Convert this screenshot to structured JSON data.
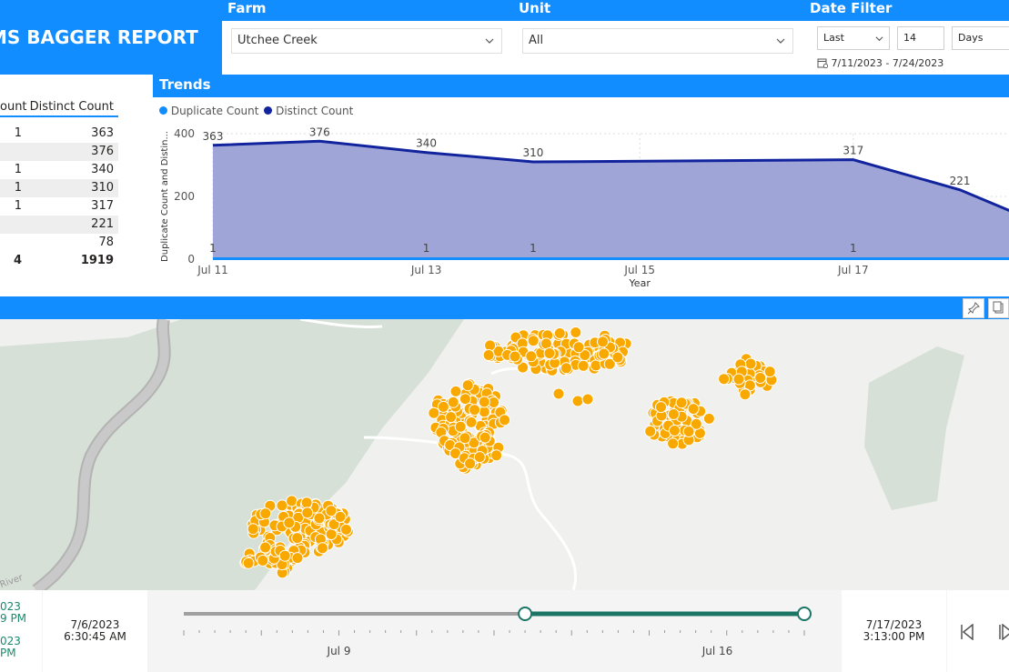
{
  "header": {
    "title": "MS BAGGER REPORT"
  },
  "farm": {
    "label": "Farm",
    "value": "Utchee Creek"
  },
  "unit": {
    "label": "Unit",
    "value": "All"
  },
  "date_filter": {
    "label": "Date Filter",
    "mode": "Last",
    "amount": "14",
    "period": "Days",
    "range": "7/11/2023 - 7/24/2023"
  },
  "table": {
    "col1_header": "ount",
    "col2_header": "Distinct Count",
    "rows": [
      {
        "c1": "1",
        "c2": "363"
      },
      {
        "c1": "",
        "c2": "376"
      },
      {
        "c1": "1",
        "c2": "340"
      },
      {
        "c1": "1",
        "c2": "310"
      },
      {
        "c1": "1",
        "c2": "317"
      },
      {
        "c1": "",
        "c2": "221"
      },
      {
        "c1": "",
        "c2": "78"
      }
    ],
    "total": {
      "c1": "4",
      "c2": "1919"
    }
  },
  "trends": {
    "title": "Trends",
    "legend": [
      "Duplicate Count",
      "Distinct Count"
    ]
  },
  "chart_data": {
    "type": "area",
    "title": "",
    "xlabel": "Year",
    "ylabel": "Duplicate Count and Distin...",
    "ylim": [
      0,
      400
    ],
    "yticks": [
      "0",
      "200",
      "400"
    ],
    "xticks": [
      "Jul 11",
      "Jul 13",
      "Jul 15",
      "Jul 17"
    ],
    "series": [
      {
        "name": "Distinct Count",
        "color": "#12239E",
        "x": [
          "Jul 11",
          "Jul 12",
          "Jul 13",
          "Jul 14",
          "Jul 17",
          "Jul 18",
          "Jul 19"
        ],
        "values": [
          363,
          376,
          340,
          310,
          317,
          221,
          78
        ]
      },
      {
        "name": "Duplicate Count",
        "color": "#118DFF",
        "x": [
          "Jul 11",
          "Jul 13",
          "Jul 14",
          "Jul 17"
        ],
        "values": [
          1,
          1,
          1,
          1
        ]
      }
    ],
    "data_labels": [
      "363",
      "376",
      "340",
      "310",
      "317",
      "221"
    ],
    "dup_labels": [
      "1",
      "1",
      "1",
      "1"
    ]
  },
  "map": {
    "river_label": "River",
    "marker_color": "#F9A800"
  },
  "timeline": {
    "left_date_partial_1": "023",
    "left_time_partial_1": "9 PM",
    "left_date_partial_2": "023",
    "left_time_partial_2": "PM",
    "start_date": "7/6/2023",
    "start_time": "6:30:45 AM",
    "end_date": "7/17/2023",
    "end_time": "3:13:00 PM",
    "tick_labels": [
      "Jul 9",
      "Jul 16"
    ],
    "selected_start_fraction": 0.55,
    "selected_end_fraction": 1.0
  }
}
